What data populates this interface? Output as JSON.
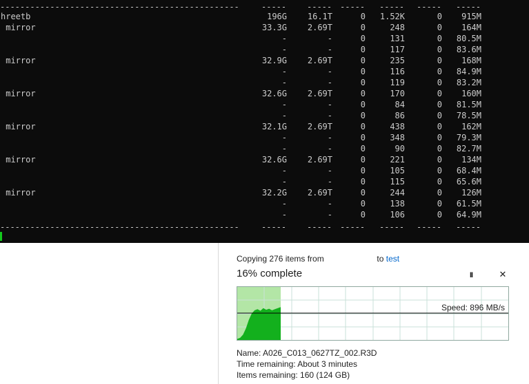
{
  "terminal": {
    "separator_name": "------------------------------------------------",
    "separator_cols": [
      "-----",
      "-----",
      "-----",
      "-----",
      "-----",
      "-----"
    ],
    "rows": [
      {
        "name": "hreetb",
        "alloc": "196G",
        "free": "16.1T",
        "ops_r": "0",
        "ops_w": "1.52K",
        "bw_r": "0",
        "bw_w": "915M"
      },
      {
        "name": " mirror",
        "alloc": "33.3G",
        "free": "2.69T",
        "ops_r": "0",
        "ops_w": "248",
        "bw_r": "0",
        "bw_w": "164M"
      },
      {
        "name": "",
        "alloc": "-",
        "free": "-",
        "ops_r": "0",
        "ops_w": "131",
        "bw_r": "0",
        "bw_w": "80.5M"
      },
      {
        "name": "",
        "alloc": "-",
        "free": "-",
        "ops_r": "0",
        "ops_w": "117",
        "bw_r": "0",
        "bw_w": "83.6M"
      },
      {
        "name": " mirror",
        "alloc": "32.9G",
        "free": "2.69T",
        "ops_r": "0",
        "ops_w": "235",
        "bw_r": "0",
        "bw_w": "168M"
      },
      {
        "name": "",
        "alloc": "-",
        "free": "-",
        "ops_r": "0",
        "ops_w": "116",
        "bw_r": "0",
        "bw_w": "84.9M"
      },
      {
        "name": "",
        "alloc": "-",
        "free": "-",
        "ops_r": "0",
        "ops_w": "119",
        "bw_r": "0",
        "bw_w": "83.2M"
      },
      {
        "name": " mirror",
        "alloc": "32.6G",
        "free": "2.69T",
        "ops_r": "0",
        "ops_w": "170",
        "bw_r": "0",
        "bw_w": "160M"
      },
      {
        "name": "",
        "alloc": "-",
        "free": "-",
        "ops_r": "0",
        "ops_w": "84",
        "bw_r": "0",
        "bw_w": "81.5M"
      },
      {
        "name": "",
        "alloc": "-",
        "free": "-",
        "ops_r": "0",
        "ops_w": "86",
        "bw_r": "0",
        "bw_w": "78.5M"
      },
      {
        "name": " mirror",
        "alloc": "32.1G",
        "free": "2.69T",
        "ops_r": "0",
        "ops_w": "438",
        "bw_r": "0",
        "bw_w": "162M"
      },
      {
        "name": "",
        "alloc": "-",
        "free": "-",
        "ops_r": "0",
        "ops_w": "348",
        "bw_r": "0",
        "bw_w": "79.3M"
      },
      {
        "name": "",
        "alloc": "-",
        "free": "-",
        "ops_r": "0",
        "ops_w": "90",
        "bw_r": "0",
        "bw_w": "82.7M"
      },
      {
        "name": " mirror",
        "alloc": "32.6G",
        "free": "2.69T",
        "ops_r": "0",
        "ops_w": "221",
        "bw_r": "0",
        "bw_w": "134M"
      },
      {
        "name": "",
        "alloc": "-",
        "free": "-",
        "ops_r": "0",
        "ops_w": "105",
        "bw_r": "0",
        "bw_w": "68.4M"
      },
      {
        "name": "",
        "alloc": "-",
        "free": "-",
        "ops_r": "0",
        "ops_w": "115",
        "bw_r": "0",
        "bw_w": "65.6M"
      },
      {
        "name": " mirror",
        "alloc": "32.2G",
        "free": "2.69T",
        "ops_r": "0",
        "ops_w": "244",
        "bw_r": "0",
        "bw_w": "126M"
      },
      {
        "name": "",
        "alloc": "-",
        "free": "-",
        "ops_r": "0",
        "ops_w": "138",
        "bw_r": "0",
        "bw_w": "61.5M"
      },
      {
        "name": "",
        "alloc": "-",
        "free": "-",
        "ops_r": "0",
        "ops_w": "106",
        "bw_r": "0",
        "bw_w": "64.9M"
      }
    ],
    "colors": {
      "background": "#0c0c0c",
      "text": "#cccccc",
      "cursor": "#13c91c"
    }
  },
  "copy_dialog": {
    "copy_prefix": "Copying 276 items from",
    "copy_to": "to",
    "destination": "test",
    "progress_title": "16% complete",
    "progress_fraction": 0.16,
    "pause_icon": "pause-icon",
    "close_icon": "close-icon",
    "pause_glyph": "II",
    "close_glyph": "✕",
    "speed_label": "Speed: 896 MB/s",
    "name_label": "Name:",
    "name_value": "A026_C013_0627TZ_002.R3D",
    "time_label": "Time remaining:",
    "time_value": "About 3 minutes",
    "items_label": "Items remaining:",
    "items_value": "160 (124 GB)",
    "colors": {
      "graph_fill": "#13b01d",
      "graph_progress_bg": "#b3e6a6",
      "grid": "#c9e1d8",
      "link": "#0066cc"
    }
  }
}
